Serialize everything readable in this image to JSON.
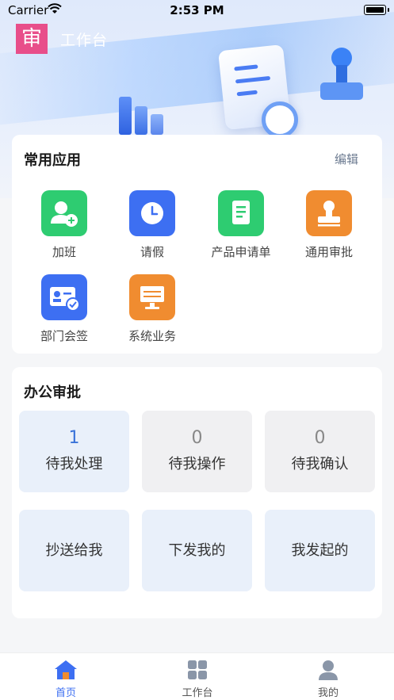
{
  "status_bar": {
    "carrier": "Carrier",
    "time": "2:53 PM"
  },
  "header": {
    "logo_char": "审",
    "title": "工作台"
  },
  "common_apps": {
    "title": "常用应用",
    "edit_label": "编辑",
    "items": [
      {
        "label": "加班",
        "icon": "user-add-icon",
        "color": "#2ecc71"
      },
      {
        "label": "请假",
        "icon": "clock-icon",
        "color": "#3d6ff2"
      },
      {
        "label": "产品申请单",
        "icon": "document-icon",
        "color": "#2ecc71"
      },
      {
        "label": "通用审批",
        "icon": "stamp-icon",
        "color": "#f08c30"
      },
      {
        "label": "部门会签",
        "icon": "id-card-check-icon",
        "color": "#3d6ff2"
      },
      {
        "label": "系统业务",
        "icon": "monitor-icon",
        "color": "#f08c30"
      }
    ]
  },
  "office_approval": {
    "title": "办公审批",
    "tiles": [
      {
        "count": "1",
        "label": "待我处理"
      },
      {
        "count": "0",
        "label": "待我操作"
      },
      {
        "count": "0",
        "label": "待我确认"
      },
      {
        "label": "抄送给我"
      },
      {
        "label": "下发我的"
      },
      {
        "label": "我发起的"
      }
    ]
  },
  "tabbar": {
    "items": [
      {
        "label": "首页",
        "icon": "home-icon",
        "active": true
      },
      {
        "label": "工作台",
        "icon": "grid-icon",
        "active": false
      },
      {
        "label": "我的",
        "icon": "profile-icon",
        "active": false
      }
    ],
    "active_color": "#3d6ff2",
    "inactive_color": "#555555"
  }
}
